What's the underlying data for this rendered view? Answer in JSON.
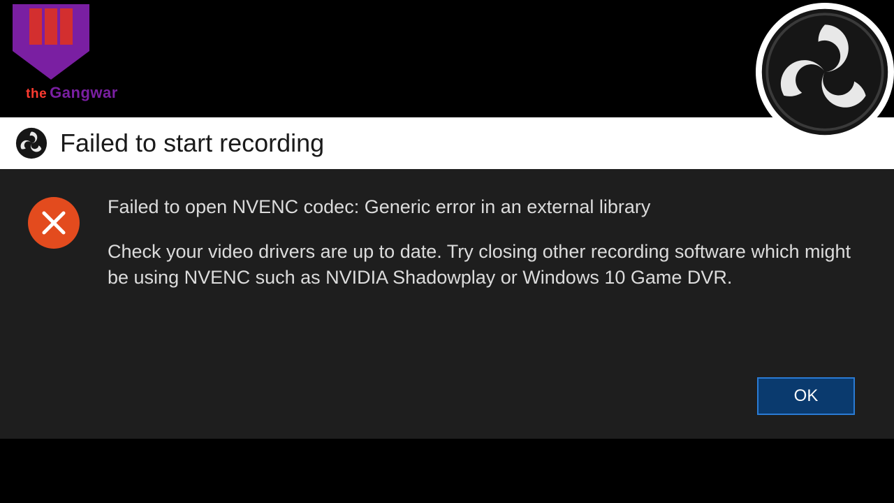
{
  "brand_overlay": {
    "word_a": "the",
    "word_b": "Gangwar"
  },
  "dialog": {
    "title": "Failed to start recording",
    "error_line": "Failed to open NVENC codec: Generic error in an external library",
    "help_text": "Check your video drivers are up to date. Try closing other recording software which might be using NVENC such as NVIDIA Shadowplay or Windows 10 Game DVR.",
    "ok_label": "OK"
  },
  "icons": {
    "title_icon": "obs-icon",
    "overlay_logo": "obs-icon",
    "error_icon": "error-x-icon"
  },
  "colors": {
    "dialog_bg": "#1e1e1e",
    "error_red": "#e34b1e",
    "button_bg": "#0a3a6e",
    "button_border": "#2a7bd4"
  }
}
